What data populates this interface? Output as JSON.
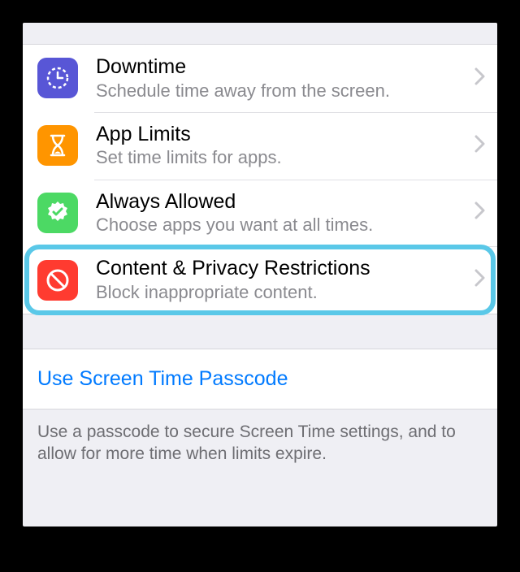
{
  "rows": [
    {
      "title": "Downtime",
      "subtitle": "Schedule time away from the screen."
    },
    {
      "title": "App Limits",
      "subtitle": "Set time limits for apps."
    },
    {
      "title": "Always Allowed",
      "subtitle": "Choose apps you want at all times."
    },
    {
      "title": "Content & Privacy Restrictions",
      "subtitle": "Block inappropriate content."
    }
  ],
  "link": {
    "label": "Use Screen Time Passcode"
  },
  "footer": "Use a passcode to secure Screen Time settings, and to allow for more time when limits expire."
}
